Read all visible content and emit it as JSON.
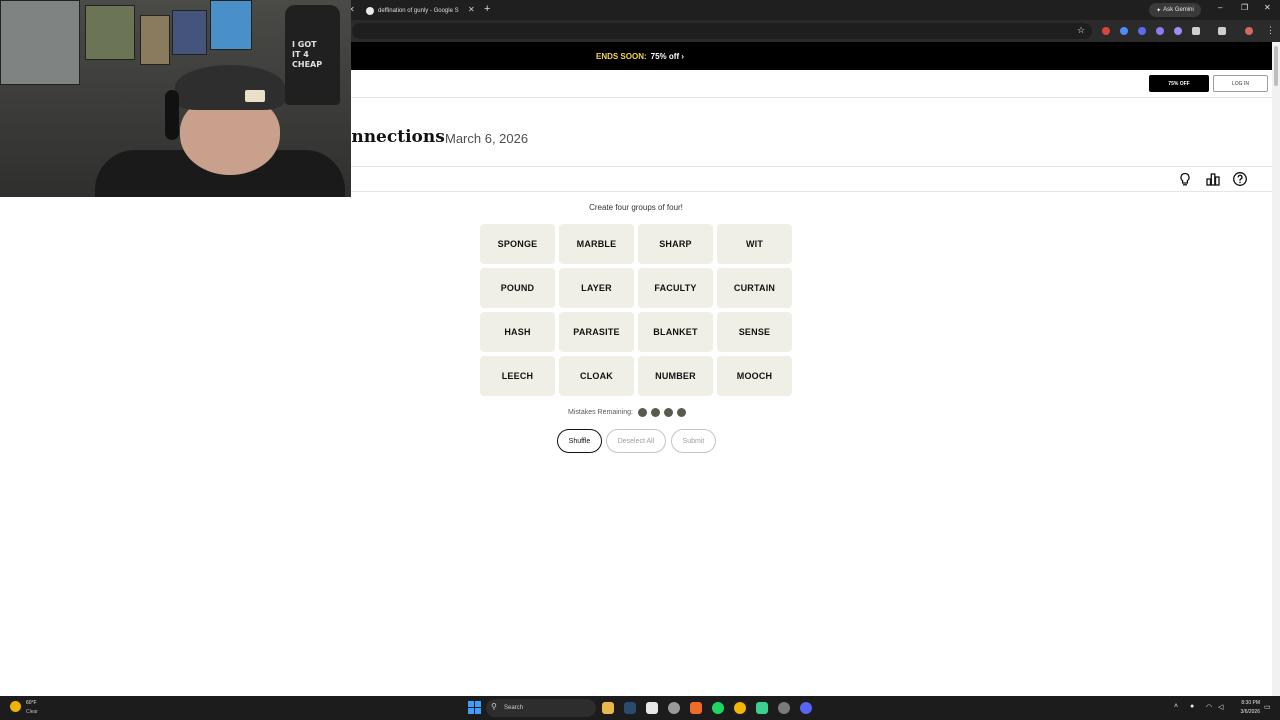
{
  "browser": {
    "tabs": [
      {
        "label": "deffination of gunly - Google S"
      }
    ],
    "new_tab": "+",
    "ask_gemini": "Ask Gemini",
    "window_controls": {
      "minimize": "–",
      "maximize": "❐",
      "close": "✕"
    }
  },
  "promo_banner": {
    "ends": "ENDS SOON:",
    "offer": "75% off ›"
  },
  "header": {
    "offer_button": "75% OFF",
    "login_button": "LOG IN"
  },
  "game": {
    "title": "onnections",
    "date": "March 6, 2026",
    "instructions": "Create four groups of four!",
    "tiles": [
      "SPONGE",
      "MARBLE",
      "SHARP",
      "WIT",
      "POUND",
      "LAYER",
      "FACULTY",
      "CURTAIN",
      "HASH",
      "PARASITE",
      "BLANKET",
      "SENSE",
      "LEECH",
      "CLOAK",
      "NUMBER",
      "MOOCH"
    ],
    "mistakes_label": "Mistakes Remaining:",
    "mistakes_remaining": 4,
    "buttons": {
      "shuffle": "Shuffle",
      "deselect": "Deselect All",
      "submit": "Submit"
    },
    "toolbar_icons": [
      "hint-lightbulb-icon",
      "stats-bar-chart-icon",
      "help-question-icon"
    ]
  },
  "webcam": {
    "shirt_text": [
      "I GOT",
      "IT 4",
      "CHEAP"
    ]
  },
  "taskbar": {
    "weather_temp": "60°F",
    "weather_desc": "Clear",
    "search_placeholder": "Search",
    "time": "8:30 PM",
    "date": "3/6/2026"
  },
  "colors": {
    "tile_bg": "#efefe6",
    "dot": "#5a594e",
    "banner_accent": "#f3d35a"
  }
}
